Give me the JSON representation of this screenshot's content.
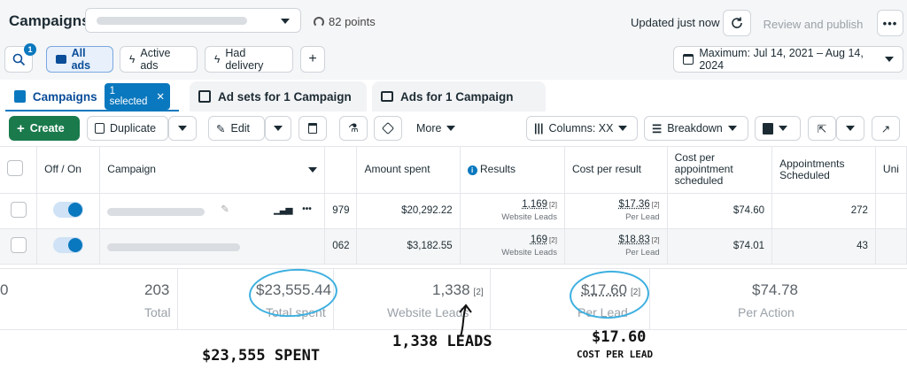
{
  "header": {
    "title": "Campaigns",
    "points": "82 points",
    "updated": "Updated just now",
    "review_publish": "Review and publish",
    "more_dots": "•••",
    "search_badge": "1"
  },
  "filters": {
    "all_ads": "All ads",
    "active_ads": "Active ads",
    "had_delivery": "Had delivery",
    "add": "+",
    "date_range": "Maximum: Jul 14, 2021 – Aug 14, 2024"
  },
  "tabs": {
    "campaigns": "Campaigns",
    "selected": "1 selected",
    "adsets": "Ad sets for 1 Campaign",
    "ads": "Ads for 1 Campaign"
  },
  "toolbar": {
    "create": "Create",
    "duplicate": "Duplicate",
    "edit": "Edit",
    "more": "More",
    "columns": "Columns: XX",
    "breakdown": "Breakdown"
  },
  "table": {
    "headers": {
      "offon": "Off / On",
      "campaign": "Campaign",
      "amount": "Amount spent",
      "results": "Results",
      "cpr": "Cost per result",
      "cpas": "Cost per appointment scheduled",
      "appts": "Appointments Scheduled",
      "uni": "Uni"
    },
    "rows": [
      {
        "trunc": "979",
        "amount": "$20,292.22",
        "results": "1,169",
        "results_sub": "Website Leads",
        "cpr": "$17.36",
        "cpr_sub": "Per Lead",
        "cpas": "$74.60",
        "appts": "272",
        "mark": "[2]"
      },
      {
        "trunc": "062",
        "amount": "$3,182.55",
        "results": "169",
        "results_sub": "Website Leads",
        "cpr": "$18.83",
        "cpr_sub": "Per Lead",
        "cpas": "$74.01",
        "appts": "43",
        "mark": "[2]"
      }
    ],
    "row_more": "•••"
  },
  "summary": {
    "count": "203",
    "count_label": "Total",
    "spent": "$23,555.44",
    "spent_label": "Total spent",
    "leads": "1,338",
    "leads_mark": "[2]",
    "leads_label": "Website Leads",
    "cpl": "$17.60",
    "cpl_mark": "[2]",
    "cpl_label": "Per Lead",
    "cpa": "$74.78",
    "cpa_label": "Per Action",
    "left_edge": "0"
  },
  "annotations": {
    "spent": "$23,555 SPENT",
    "leads": "1,338 LEADS",
    "cpl_value": "$17.60",
    "cpl_label": "COST PER LEAD"
  },
  "colors": {
    "accent": "#0a78be",
    "create": "#1a7a4c",
    "annotation_circle": "#3db0e0"
  }
}
